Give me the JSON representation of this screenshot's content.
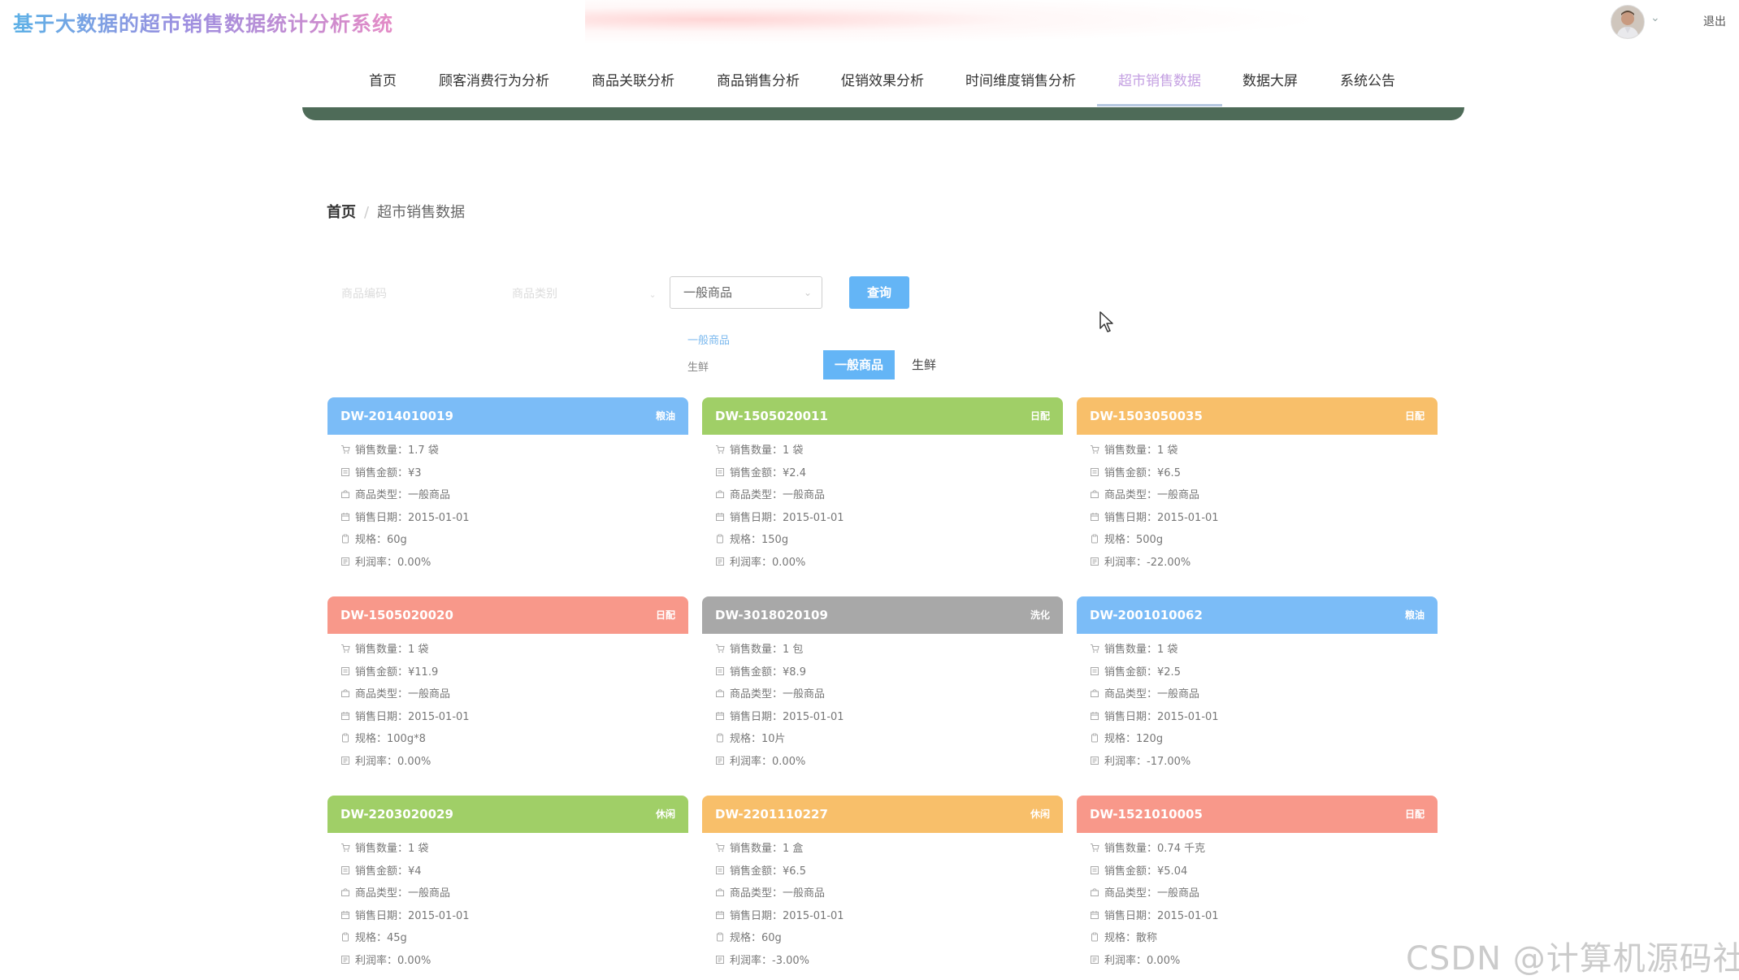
{
  "header": {
    "site_title": "基于大数据的超市销售数据统计分析系统",
    "logout_label": "退出",
    "avatar_icon": "user-avatar-icon",
    "caret_icon": "chevron-down-icon"
  },
  "nav": {
    "items": [
      {
        "label": "首页",
        "active": false
      },
      {
        "label": "顾客消费行为分析",
        "active": false
      },
      {
        "label": "商品关联分析",
        "active": false
      },
      {
        "label": "商品销售分析",
        "active": false
      },
      {
        "label": "促销效果分析",
        "active": false
      },
      {
        "label": "时间维度销售分析",
        "active": false
      },
      {
        "label": "超市销售数据",
        "active": true
      },
      {
        "label": "数据大屏",
        "active": false
      },
      {
        "label": "系统公告",
        "active": false
      }
    ],
    "active_color": "#c4a0e2",
    "bar_color": "#4e6b58"
  },
  "breadcrumb": {
    "home": "首页",
    "separator": "/",
    "current": "超市销售数据"
  },
  "filters": {
    "code_placeholder": "商品编码",
    "category_placeholder": "商品类别",
    "type_selected": "一般商品",
    "query_label": "查询",
    "dropdown_options": [
      "一般商品",
      "生鲜"
    ],
    "segment_options": [
      "一般商品",
      "生鲜"
    ],
    "segment_active": "一般商品"
  },
  "card_labels": {
    "qty": "销售数量：",
    "amount": "销售金额：",
    "type": "商品类型：",
    "date": "销售日期：",
    "spec": "规格：",
    "profit": "利润率："
  },
  "card_colors": {
    "blue": "#7bbcf7",
    "green": "#a0cf67",
    "orange": "#f8bf6a",
    "red": "#f8988a",
    "gray": "#a8a8a8"
  },
  "cards": [
    {
      "code": "DW-2014010019",
      "tag": "粮油",
      "color": "blue",
      "qty": "1.7 袋",
      "amount": "¥3",
      "type": "一般商品",
      "date": "2015-01-01",
      "spec": "60g",
      "profit": "0.00%"
    },
    {
      "code": "DW-1505020011",
      "tag": "日配",
      "color": "green",
      "qty": "1 袋",
      "amount": "¥2.4",
      "type": "一般商品",
      "date": "2015-01-01",
      "spec": "150g",
      "profit": "0.00%"
    },
    {
      "code": "DW-1503050035",
      "tag": "日配",
      "color": "orange",
      "qty": "1 袋",
      "amount": "¥6.5",
      "type": "一般商品",
      "date": "2015-01-01",
      "spec": "500g",
      "profit": "-22.00%"
    },
    {
      "code": "DW-1505020020",
      "tag": "日配",
      "color": "red",
      "qty": "1 袋",
      "amount": "¥11.9",
      "type": "一般商品",
      "date": "2015-01-01",
      "spec": "100g*8",
      "profit": "0.00%"
    },
    {
      "code": "DW-3018020109",
      "tag": "洗化",
      "color": "gray",
      "qty": "1 包",
      "amount": "¥8.9",
      "type": "一般商品",
      "date": "2015-01-01",
      "spec": "10片",
      "profit": "0.00%"
    },
    {
      "code": "DW-2001010062",
      "tag": "粮油",
      "color": "blue",
      "qty": "1 袋",
      "amount": "¥2.5",
      "type": "一般商品",
      "date": "2015-01-01",
      "spec": "120g",
      "profit": "-17.00%"
    },
    {
      "code": "DW-2203020029",
      "tag": "休闲",
      "color": "green",
      "qty": "1 袋",
      "amount": "¥4",
      "type": "一般商品",
      "date": "2015-01-01",
      "spec": "45g",
      "profit": "0.00%"
    },
    {
      "code": "DW-2201110227",
      "tag": "休闲",
      "color": "orange",
      "qty": "1 盒",
      "amount": "¥6.5",
      "type": "一般商品",
      "date": "2015-01-01",
      "spec": "60g",
      "profit": "-3.00%"
    },
    {
      "code": "DW-1521010005",
      "tag": "日配",
      "color": "red",
      "qty": "0.74 千克",
      "amount": "¥5.04",
      "type": "一般商品",
      "date": "2015-01-01",
      "spec": "散称",
      "profit": "0.00%"
    }
  ],
  "row_icons": [
    "cart-icon",
    "receipt-icon",
    "bag-icon",
    "calendar-icon",
    "clipboard-icon",
    "note-icon"
  ],
  "watermark": "CSDN @计算机源码社"
}
